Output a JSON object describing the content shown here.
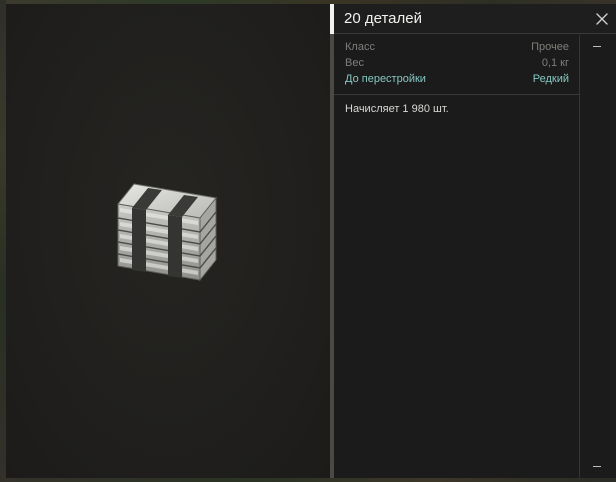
{
  "item": {
    "title": "20 деталей",
    "close_icon": "close-icon",
    "properties": [
      {
        "key": "Класс",
        "value": "Прочее"
      },
      {
        "key": "Вес",
        "value": "0,1 кг"
      },
      {
        "key": "До перестройки",
        "value": "Редкий"
      }
    ],
    "description": "Начисляет 1 980 шт."
  },
  "colors": {
    "panel_bg": "#1b1b1b",
    "label_gray": "#7e7e7a",
    "accent_teal": "#86c8c2",
    "title_white": "#f0f0ee"
  },
  "scrollbar": {
    "top_glyph": "minus",
    "bottom_glyph": "minus"
  },
  "preview": {
    "icon": "parts-stack-icon"
  }
}
